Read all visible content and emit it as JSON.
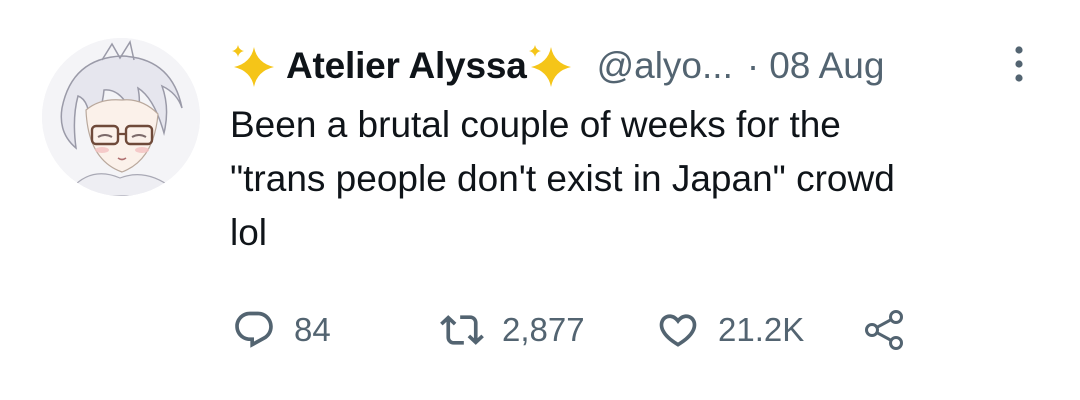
{
  "tweet": {
    "author": {
      "display_name": "Atelier Alyssa",
      "handle": "@alyo...",
      "name_emoji": "sparkles-icon"
    },
    "separator": "·",
    "date": "08 Aug",
    "text_lines": [
      "Been a brutal couple of weeks for the",
      "\"trans people don't exist in Japan\" crowd",
      "lol"
    ],
    "stats": {
      "replies": "84",
      "retweets": "2,877",
      "likes": "21.2K"
    }
  },
  "colors": {
    "text": "#0f1419",
    "secondary": "#536471",
    "sparkle": "#f5c518"
  }
}
